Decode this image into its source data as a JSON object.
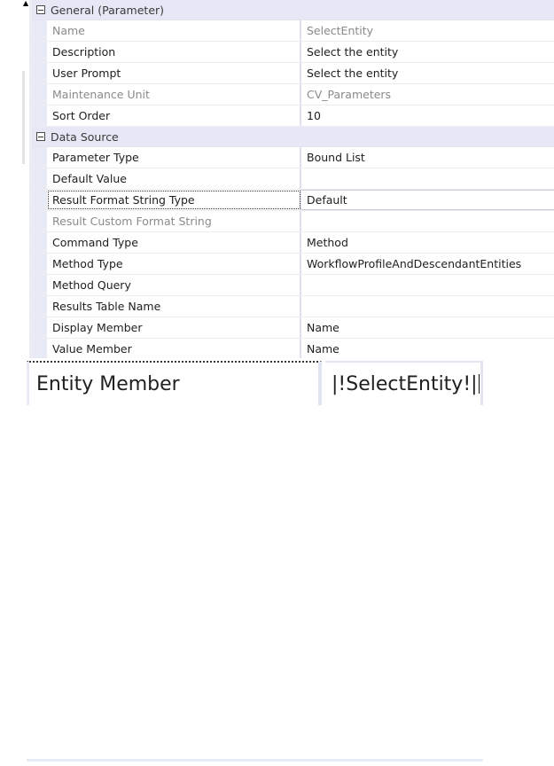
{
  "grid": {
    "categories": [
      {
        "label": "General (Parameter)",
        "rows": [
          {
            "name": "Name",
            "value": "SelectEntity",
            "disabled": true
          },
          {
            "name": "Description",
            "value": "Select the entity",
            "disabled": false
          },
          {
            "name": "User Prompt",
            "value": "Select the entity",
            "disabled": false
          },
          {
            "name": "Maintenance Unit",
            "value": "CV_Parameters",
            "disabled": true
          },
          {
            "name": "Sort Order",
            "value": "10",
            "disabled": false
          }
        ]
      },
      {
        "label": "Data Source",
        "rows": [
          {
            "name": "Parameter Type",
            "value": "Bound List",
            "disabled": false
          },
          {
            "name": "Default Value",
            "value": "",
            "disabled": false
          },
          {
            "name": "Result Format String Type",
            "value": "Default",
            "disabled": false,
            "focused": true
          },
          {
            "name": "Result Custom Format String",
            "value": "",
            "disabled": true
          },
          {
            "name": "Command Type",
            "value": "Method",
            "disabled": false
          },
          {
            "name": "Method Type",
            "value": "WorkflowProfileAndDescendantEntities",
            "disabled": false
          },
          {
            "name": "Method Query",
            "value": "",
            "disabled": false
          },
          {
            "name": "Results Table Name",
            "value": "",
            "disabled": false
          },
          {
            "name": "Display Member",
            "value": "Name",
            "disabled": false
          },
          {
            "name": "Value Member",
            "value": "Name",
            "disabled": false
          }
        ]
      }
    ]
  },
  "zoomed": {
    "name": "Entity Member",
    "value": "|!SelectEntity!|"
  },
  "colors": {
    "category_background": "#e6e8f6",
    "disabled_text": "#8a8a8a"
  }
}
